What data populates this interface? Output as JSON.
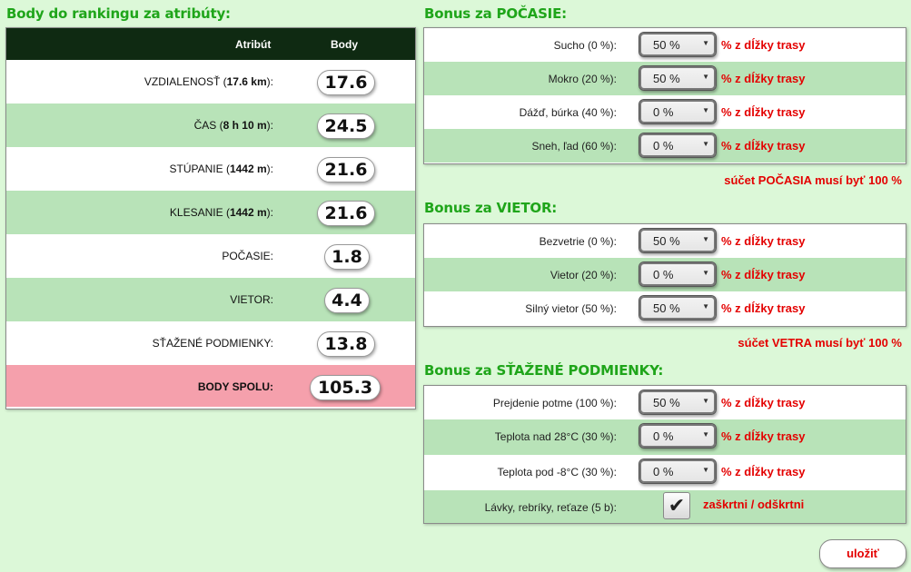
{
  "left": {
    "title": "Body do rankingu za atribúty:",
    "col_attr": "Atribút",
    "col_points": "Body",
    "rows": [
      {
        "pre": "VZDIALENOSŤ (",
        "bold": "17.6 km",
        "post": "):",
        "value": "17.6"
      },
      {
        "pre": "ČAS (",
        "bold": "8 h 10 m",
        "post": "):",
        "value": "24.5"
      },
      {
        "pre": "STÚPANIE (",
        "bold": "1442 m",
        "post": "):",
        "value": "21.6"
      },
      {
        "pre": "KLESANIE (",
        "bold": "1442 m",
        "post": "):",
        "value": "21.6"
      },
      {
        "pre": "POČASIE:",
        "bold": "",
        "post": "",
        "value": "1.8"
      },
      {
        "pre": "VIETOR:",
        "bold": "",
        "post": "",
        "value": "4.4"
      },
      {
        "pre": "SŤAŽENÉ PODMIENKY:",
        "bold": "",
        "post": "",
        "value": "13.8"
      }
    ],
    "total": {
      "label": "BODY SPOLU:",
      "value": "105.3"
    }
  },
  "weather": {
    "title": "Bonus za POČASIE:",
    "rows": [
      {
        "label": "Sucho (0 %):",
        "value": "50 %",
        "unit": "% z dĺžky trasy"
      },
      {
        "label": "Mokro (20 %):",
        "value": "50 %",
        "unit": "% z dĺžky trasy"
      },
      {
        "label": "Dážď, búrka (40 %):",
        "value": "0 %",
        "unit": "% z dĺžky trasy"
      },
      {
        "label": "Sneh, ľad (60 %):",
        "value": "0 %",
        "unit": "% z dĺžky trasy"
      }
    ],
    "warning": "súčet POČASIA musí byť 100 %"
  },
  "wind": {
    "title": "Bonus za VIETOR:",
    "rows": [
      {
        "label": "Bezvetrie (0 %):",
        "value": "50 %",
        "unit": "% z dĺžky trasy"
      },
      {
        "label": "Vietor (20 %):",
        "value": "0 %",
        "unit": "% z dĺžky trasy"
      },
      {
        "label": "Silný vietor (50 %):",
        "value": "50 %",
        "unit": "% z dĺžky trasy"
      }
    ],
    "warning": "súčet VETRA musí byť 100 %"
  },
  "hard": {
    "title": "Bonus za SŤAŽENÉ PODMIENKY:",
    "rows": [
      {
        "label": "Prejdenie potme (100 %):",
        "value": "50 %",
        "unit": "% z dĺžky trasy"
      },
      {
        "label": "Teplota nad 28°C (30 %):",
        "value": "0 %",
        "unit": "% z dĺžky trasy"
      },
      {
        "label": "Teplota pod -8°C (30 %):",
        "value": "0 %",
        "unit": "% z dĺžky trasy"
      }
    ],
    "check_label": "Lávky, rebríky, reťaze (5 b):",
    "check_mark": "✔",
    "check_toggle": "zaškrtni / odškrtni"
  },
  "save_label": "uložiť",
  "colors": {
    "accent": "#1fa51a",
    "warning": "#e40000",
    "row_alt": "#b8e3b8",
    "total_row": "#f5a0ac",
    "header": "#0f2a12"
  }
}
